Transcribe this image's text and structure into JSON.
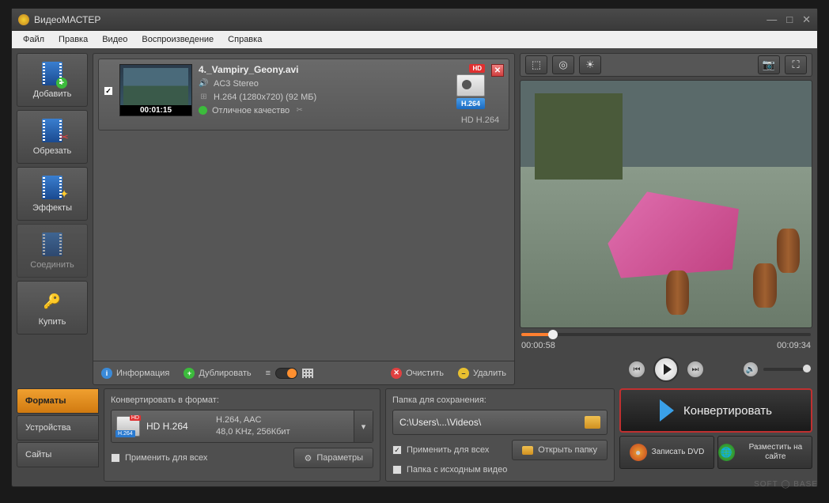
{
  "titlebar": {
    "title": "ВидеоМАСТЕР"
  },
  "menu": {
    "file": "Файл",
    "edit": "Правка",
    "video": "Видео",
    "playback": "Воспроизведение",
    "help": "Справка"
  },
  "sidebar": {
    "add": "Добавить",
    "trim": "Обрезать",
    "effects": "Эффекты",
    "join": "Соединить",
    "buy": "Купить"
  },
  "item": {
    "filename": "4._Vampiry_Geony.avi",
    "audio": "AC3 Stereo",
    "codec": "H.264 (1280x720) (92 МБ)",
    "quality": "Отличное качество",
    "duration": "00:01:15",
    "format_badge": "H.264",
    "format_label": "HD H.264",
    "hd": "HD"
  },
  "listbar": {
    "info": "Информация",
    "duplicate": "Дублировать",
    "clear": "Очистить",
    "delete": "Удалить"
  },
  "playback": {
    "current": "00:00:58",
    "total": "00:09:34",
    "progress_pct": 11
  },
  "tabs": {
    "formats": "Форматы",
    "devices": "Устройства",
    "sites": "Сайты"
  },
  "format": {
    "title": "Конвертировать в формат:",
    "name": "HD H.264",
    "detail1": "H.264, AAC",
    "detail2": "48,0 KHz, 256Кбит",
    "apply_all": "Применить для всех",
    "params": "Параметры"
  },
  "save": {
    "title": "Папка для сохранения:",
    "path": "C:\\Users\\...\\Videos\\",
    "apply_all": "Применить для всех",
    "same_folder": "Папка с исходным видео",
    "open": "Открыть папку"
  },
  "actions": {
    "convert": "Конвертировать",
    "dvd": "Записать DVD",
    "publish": "Разместить на сайте"
  },
  "watermark": "SOFT ◯ BASE"
}
